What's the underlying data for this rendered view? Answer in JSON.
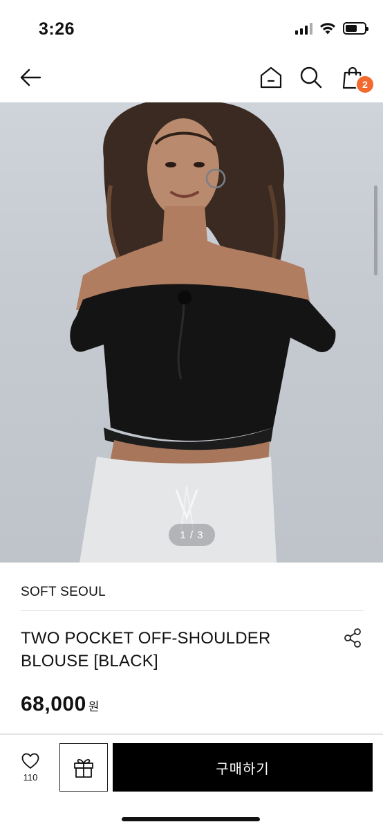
{
  "status_bar": {
    "time": "3:26"
  },
  "header": {
    "cart_count": "2"
  },
  "product": {
    "image_counter": "1 / 3",
    "brand": "SOFT SEOUL",
    "title_line1": "TWO POCKET OFF-SHOULDER",
    "title_line2": "BLOUSE [BLACK]",
    "price": "68,000",
    "currency": "원"
  },
  "bottom_bar": {
    "like_count": "110",
    "buy_label": "구매하기"
  },
  "colors": {
    "badge": "#f26a2e",
    "buy_button": "#000000"
  },
  "icons": [
    "back-arrow-icon",
    "home-icon",
    "search-icon",
    "shopping-bag-icon",
    "share-icon",
    "heart-icon",
    "gift-icon"
  ]
}
